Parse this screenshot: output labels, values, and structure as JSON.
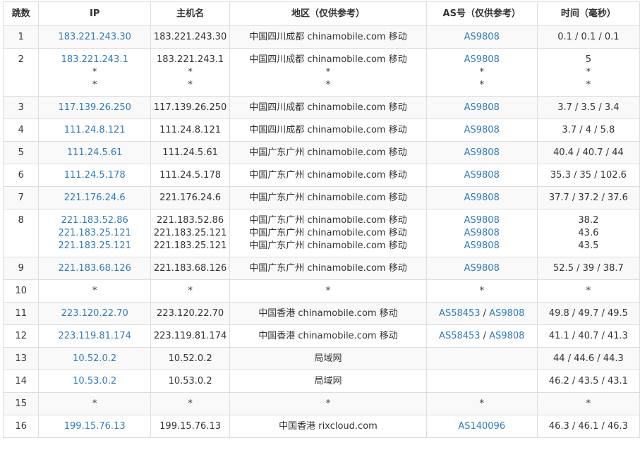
{
  "headers": {
    "hop": "跳数",
    "ip": "IP",
    "host": "主机名",
    "region": "地区（仅供参考）",
    "as": "AS号（仅供参考）",
    "time": "时间（毫秒）"
  },
  "rows": [
    {
      "hop": "1",
      "ip": [
        "183.221.243.30"
      ],
      "host": [
        "183.221.243.30"
      ],
      "region": [
        "中国四川成都 chinamobile.com 移动"
      ],
      "as": [
        [
          "AS9808"
        ]
      ],
      "time": [
        "0.1 / 0.1 / 0.1"
      ]
    },
    {
      "hop": "2",
      "ip": [
        "183.221.243.1",
        "*",
        "*"
      ],
      "host": [
        "183.221.243.1",
        "*",
        "*"
      ],
      "region": [
        "中国四川成都 chinamobile.com 移动",
        "*",
        "*"
      ],
      "as": [
        [
          "AS9808"
        ],
        [
          "*"
        ],
        [
          "*"
        ]
      ],
      "time": [
        "5",
        "*",
        "*"
      ]
    },
    {
      "hop": "3",
      "ip": [
        "117.139.26.250"
      ],
      "host": [
        "117.139.26.250"
      ],
      "region": [
        "中国四川成都 chinamobile.com 移动"
      ],
      "as": [
        [
          "AS9808"
        ]
      ],
      "time": [
        "3.7 / 3.5 / 3.4"
      ]
    },
    {
      "hop": "4",
      "ip": [
        "111.24.8.121"
      ],
      "host": [
        "111.24.8.121"
      ],
      "region": [
        "中国四川成都 chinamobile.com 移动"
      ],
      "as": [
        [
          "AS9808"
        ]
      ],
      "time": [
        "3.7 / 4 / 5.8"
      ]
    },
    {
      "hop": "5",
      "ip": [
        "111.24.5.61"
      ],
      "host": [
        "111.24.5.61"
      ],
      "region": [
        "中国广东广州 chinamobile.com 移动"
      ],
      "as": [
        [
          "AS9808"
        ]
      ],
      "time": [
        "40.4 / 40.7 / 44"
      ]
    },
    {
      "hop": "6",
      "ip": [
        "111.24.5.178"
      ],
      "host": [
        "111.24.5.178"
      ],
      "region": [
        "中国广东广州 chinamobile.com 移动"
      ],
      "as": [
        [
          "AS9808"
        ]
      ],
      "time": [
        "35.3 / 35 / 102.6"
      ]
    },
    {
      "hop": "7",
      "ip": [
        "221.176.24.6"
      ],
      "host": [
        "221.176.24.6"
      ],
      "region": [
        "中国广东广州 chinamobile.com 移动"
      ],
      "as": [
        [
          "AS9808"
        ]
      ],
      "time": [
        "37.7 / 37.2 / 37.6"
      ]
    },
    {
      "hop": "8",
      "ip": [
        "221.183.52.86",
        "221.183.25.121",
        "221.183.25.121"
      ],
      "host": [
        "221.183.52.86",
        "221.183.25.121",
        "221.183.25.121"
      ],
      "region": [
        "中国广东广州 chinamobile.com 移动",
        "中国广东广州 chinamobile.com 移动",
        "中国广东广州 chinamobile.com 移动"
      ],
      "as": [
        [
          "AS9808"
        ],
        [
          "AS9808"
        ],
        [
          "AS9808"
        ]
      ],
      "time": [
        "38.2",
        "43.6",
        "43.5"
      ]
    },
    {
      "hop": "9",
      "ip": [
        "221.183.68.126"
      ],
      "host": [
        "221.183.68.126"
      ],
      "region": [
        "中国广东广州 chinamobile.com 移动"
      ],
      "as": [
        [
          "AS9808"
        ]
      ],
      "time": [
        "52.5 / 39 / 38.7"
      ]
    },
    {
      "hop": "10",
      "ip": [
        "*"
      ],
      "host": [
        "*"
      ],
      "region": [
        "*"
      ],
      "as": [
        [
          "*"
        ]
      ],
      "time": [
        "*"
      ]
    },
    {
      "hop": "11",
      "ip": [
        "223.120.22.70"
      ],
      "host": [
        "223.120.22.70"
      ],
      "region": [
        "中国香港 chinamobile.com 移动"
      ],
      "as": [
        [
          "AS58453",
          "AS9808"
        ]
      ],
      "time": [
        "49.8 / 49.7 / 49.5"
      ]
    },
    {
      "hop": "12",
      "ip": [
        "223.119.81.174"
      ],
      "host": [
        "223.119.81.174"
      ],
      "region": [
        "中国香港 chinamobile.com 移动"
      ],
      "as": [
        [
          "AS58453",
          "AS9808"
        ]
      ],
      "time": [
        "41.1 / 40.7 / 41.3"
      ]
    },
    {
      "hop": "13",
      "ip": [
        "10.52.0.2"
      ],
      "host": [
        "10.52.0.2"
      ],
      "region": [
        "局域网"
      ],
      "as": [
        []
      ],
      "time": [
        "44 / 44.6 / 44.3"
      ]
    },
    {
      "hop": "14",
      "ip": [
        "10.53.0.2"
      ],
      "host": [
        "10.53.0.2"
      ],
      "region": [
        "局域网"
      ],
      "as": [
        []
      ],
      "time": [
        "46.2 / 43.5 / 43.1"
      ]
    },
    {
      "hop": "15",
      "ip": [
        "*"
      ],
      "host": [
        "*"
      ],
      "region": [
        "*"
      ],
      "as": [
        [
          "*"
        ]
      ],
      "time": [
        "*"
      ]
    },
    {
      "hop": "16",
      "ip": [
        "199.15.76.13"
      ],
      "host": [
        "199.15.76.13"
      ],
      "region": [
        "中国香港 rixcloud.com"
      ],
      "as": [
        [
          "AS140096"
        ]
      ],
      "time": [
        "46.3 / 46.1 / 46.3"
      ]
    }
  ],
  "colors": {
    "link": "#337ab7",
    "text": "#333333",
    "border": "#dddddd",
    "stripe": "#f9f9f9"
  }
}
